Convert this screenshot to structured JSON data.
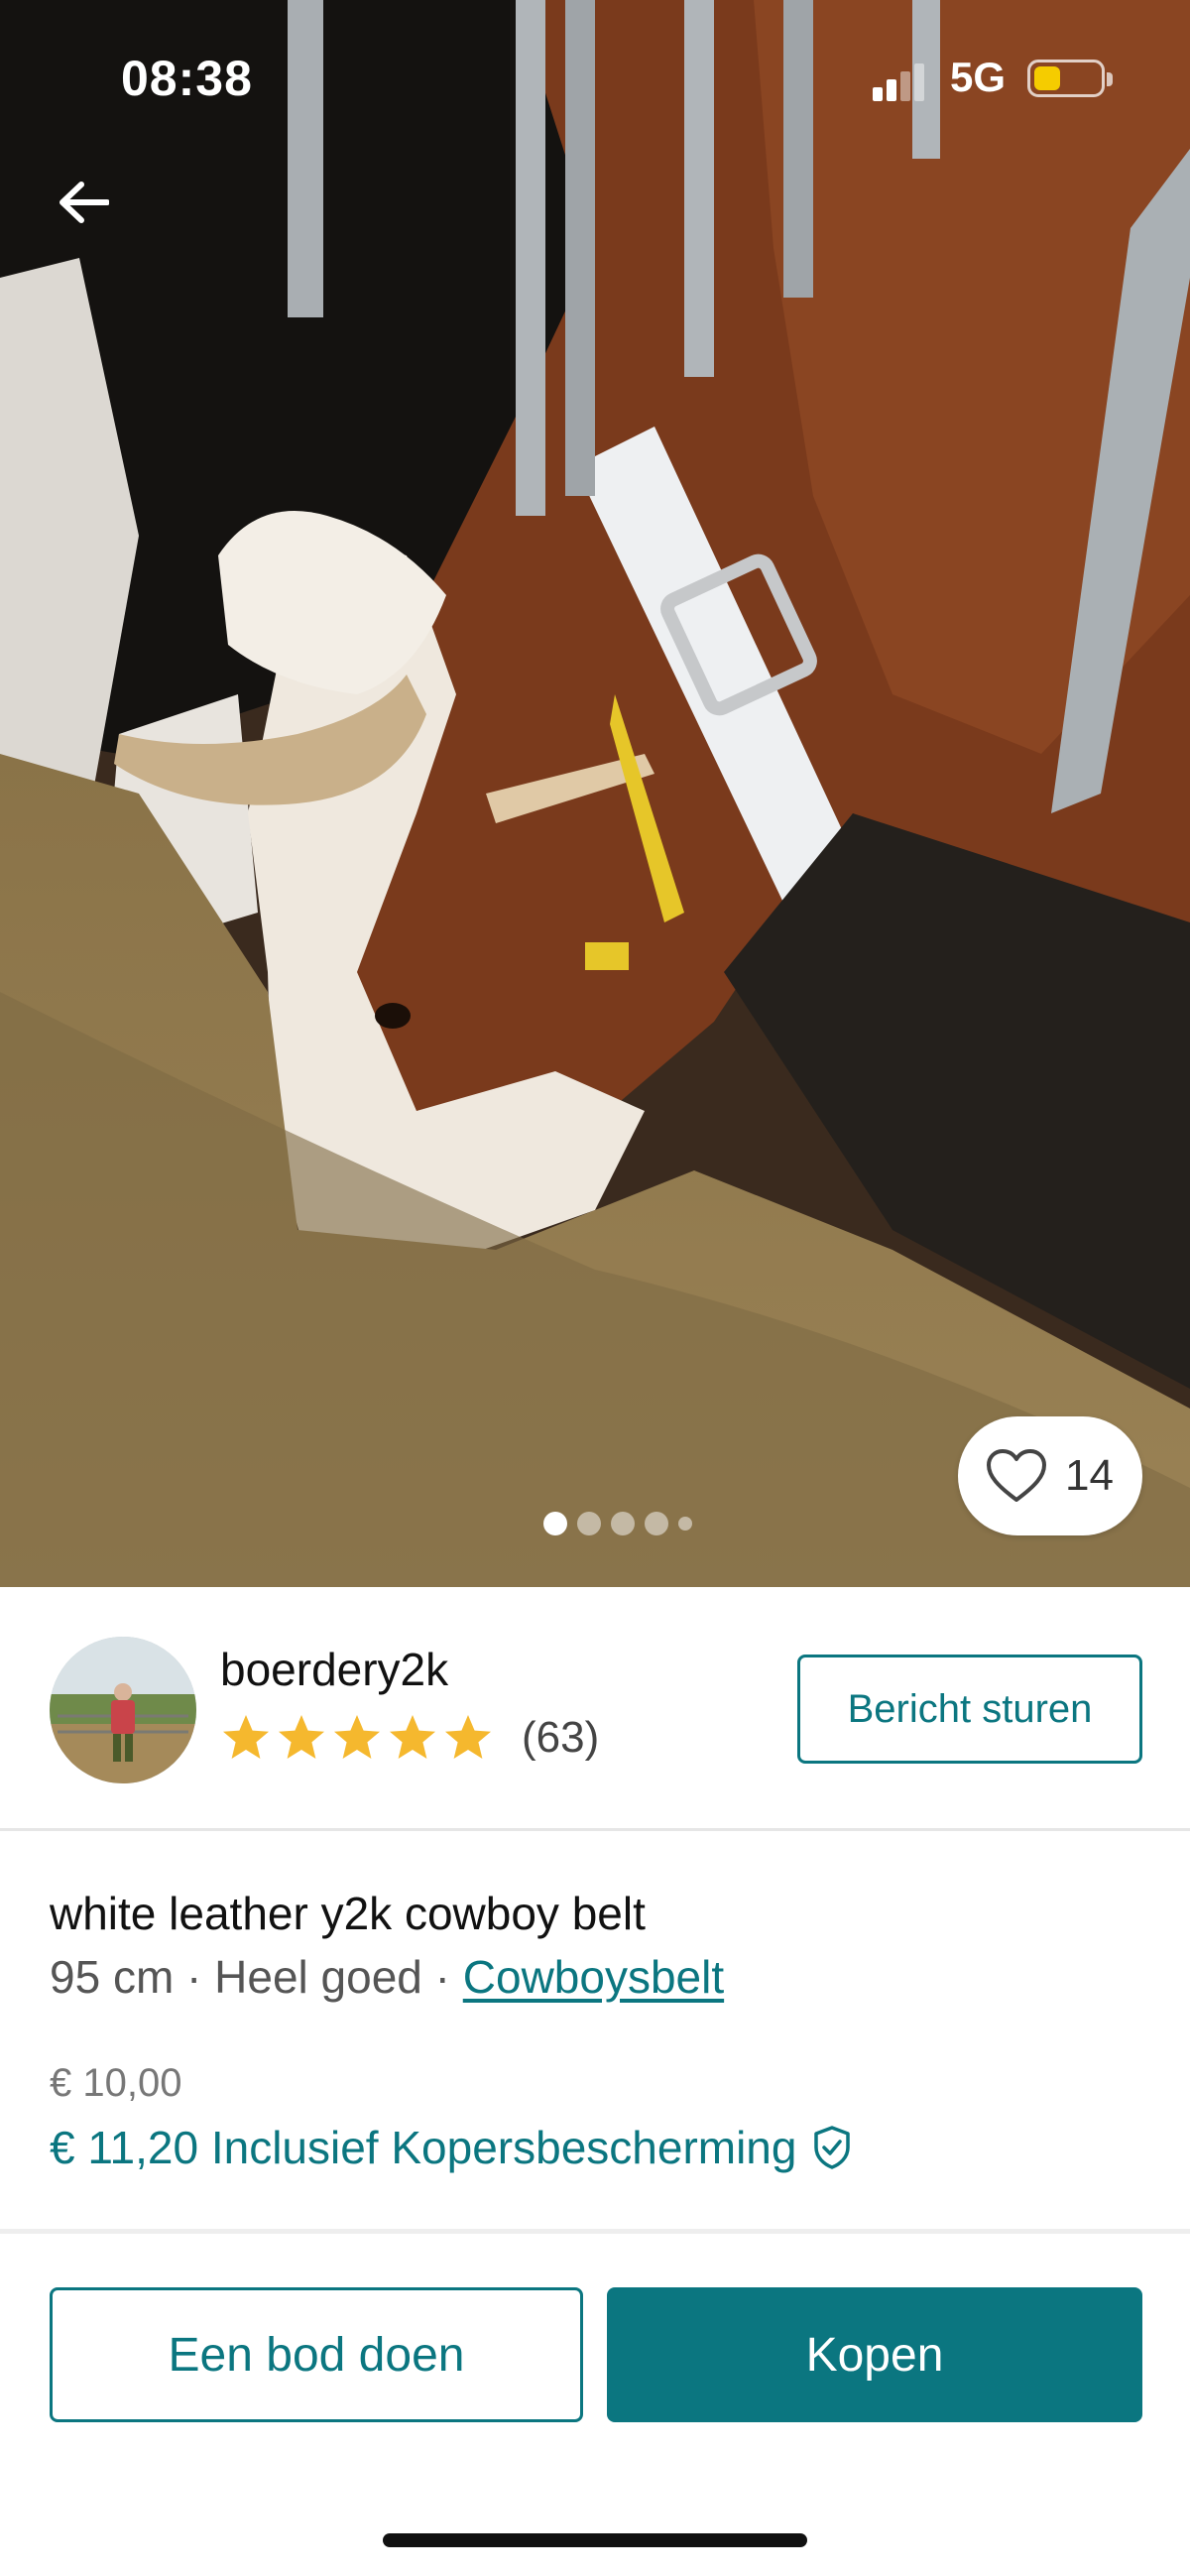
{
  "status_bar": {
    "time": "08:38",
    "network": "5G",
    "battery_level": 0.4,
    "battery_color": "#f5cc00"
  },
  "nav": {
    "back_icon": "arrow-left-icon"
  },
  "gallery": {
    "photo_description_icon": "product-photo",
    "favorite_icon": "heart-outline-icon",
    "favorite_count": "14",
    "page_count": 5,
    "active_page": 1
  },
  "seller": {
    "username": "boerdery2k",
    "rating_stars": 5,
    "review_count": "(63)",
    "message_button": "Bericht sturen"
  },
  "item": {
    "title": "white leather y2k cowboy belt",
    "size": "95 cm",
    "separator": " · ",
    "condition": "Heel goed",
    "brand": "Cowboysbelt",
    "price": "€ 10,00",
    "total_price": "€ 11,20 Inclusief Kopersbescherming",
    "protection_icon": "shield-check-icon"
  },
  "actions": {
    "offer_button": "Een bod doen",
    "buy_button": "Kopen"
  },
  "colors": {
    "accent": "#0b7680",
    "star": "#f5b82e"
  }
}
